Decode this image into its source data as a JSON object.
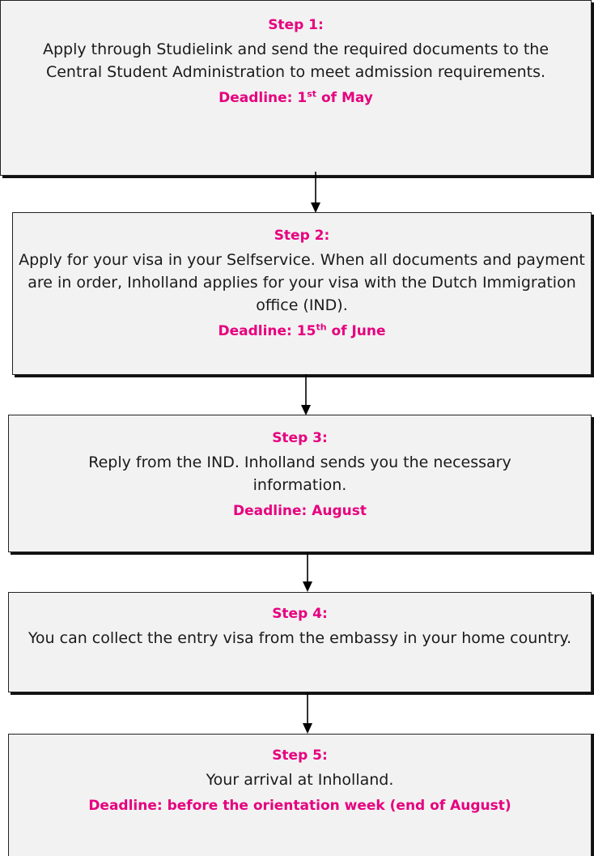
{
  "steps": [
    {
      "title": "Step 1:",
      "text": "Apply through Studielink and send the required documents to the Central Student Administration to meet admission requirements.",
      "deadline_prefix": "Deadline: 1",
      "deadline_sup": "st",
      "deadline_suffix": " of May"
    },
    {
      "title": "Step 2:",
      "text": "Apply for your visa in your Selfservice. When all documents and payment are in order, Inholland applies for your visa with the Dutch Immigration office (IND).",
      "deadline_prefix": "Deadline: 15",
      "deadline_sup": "th",
      "deadline_suffix": " of June"
    },
    {
      "title": "Step 3:",
      "text": "Reply from the IND. Inholland sends you the necessary information.",
      "deadline": "Deadline: August"
    },
    {
      "title": "Step 4:",
      "text": "You can collect the entry visa from the embassy in your home country."
    },
    {
      "title": "Step 5:",
      "text": "Your arrival at Inholland.",
      "deadline": "Deadline: before the orientation week (end of August)"
    }
  ],
  "colors": {
    "accent": "#e6007e",
    "box_fill": "#f2f2f2",
    "border": "#222222"
  }
}
